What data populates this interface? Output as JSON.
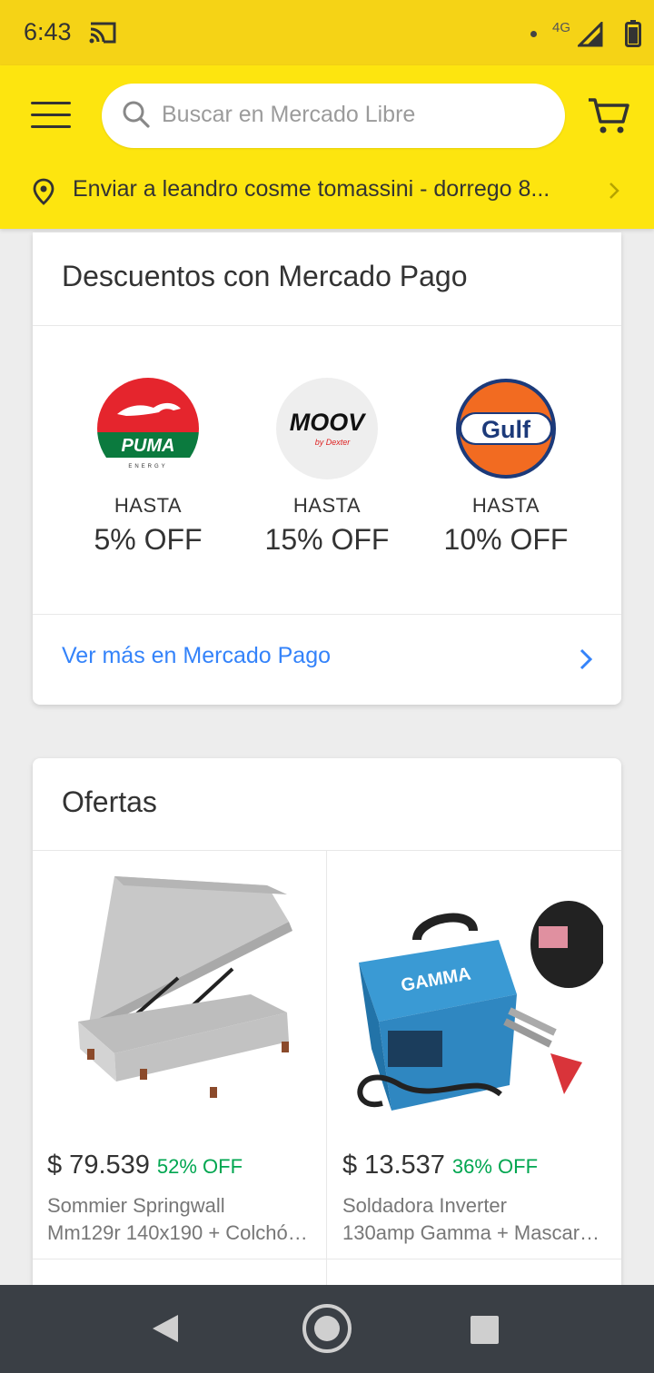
{
  "status_bar": {
    "time": "6:43",
    "network": "4G"
  },
  "header": {
    "search": {
      "placeholder": "Buscar en Mercado Libre"
    },
    "location": {
      "text": "Enviar a leandro cosme tomassini - dorrego 8..."
    }
  },
  "discounts": {
    "title": "Descuentos con Mercado Pago",
    "brands": [
      {
        "name": "Puma Energy",
        "logo_text": "PUMA",
        "logo_subtext": "ENERGY",
        "prefix": "HASTA",
        "discount": "5% OFF"
      },
      {
        "name": "Moov",
        "logo_text": "MOOV",
        "logo_subtext": "by Dexter",
        "prefix": "HASTA",
        "discount": "15% OFF"
      },
      {
        "name": "Gulf",
        "logo_text": "Gulf",
        "prefix": "HASTA",
        "discount": "10% OFF"
      }
    ],
    "more_link": "Ver más en Mercado Pago"
  },
  "offers": {
    "title": "Ofertas",
    "items": [
      {
        "price": "$ 79.539",
        "discount": "52% OFF",
        "title_line1": "Sommier Springwall",
        "title_line2": "Mm129r 140x190 + Colchón..."
      },
      {
        "price": "$ 13.537",
        "discount": "36% OFF",
        "title_line1": "Soldadora Inverter",
        "title_line2": "130amp Gamma + Mascara..."
      }
    ]
  },
  "colors": {
    "brand_yellow": "#fde50f",
    "link_blue": "#3483fa",
    "discount_green": "#00a650"
  },
  "icons": [
    "cast-icon",
    "signal-icon",
    "battery-icon",
    "menu-icon",
    "search-icon",
    "cart-icon",
    "location-pin-icon",
    "chevron-right-icon",
    "back-icon",
    "home-icon",
    "recents-icon"
  ]
}
